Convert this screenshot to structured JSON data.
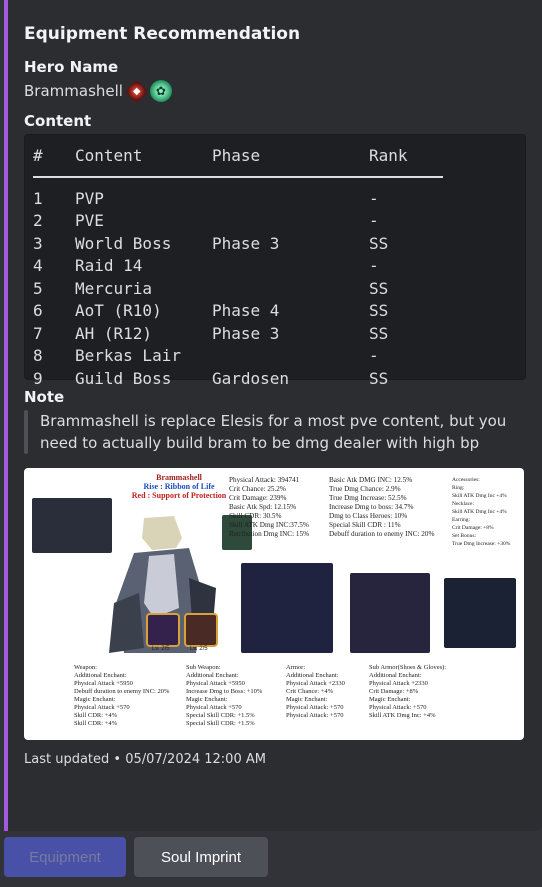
{
  "embed": {
    "title": "Equipment Recommendation",
    "hero_field": {
      "name": "Hero Name",
      "value": "Brammashell"
    },
    "content_field": {
      "name": "Content"
    },
    "table": {
      "headers": [
        "#",
        "Content",
        "Phase",
        "Rank"
      ],
      "rows": [
        [
          "1",
          "PVP",
          "",
          "-"
        ],
        [
          "2",
          "PVE",
          "",
          "-"
        ],
        [
          "3",
          "World Boss",
          "Phase 3",
          "SS"
        ],
        [
          "4",
          "Raid 14",
          "",
          "-"
        ],
        [
          "5",
          "Mercuria",
          "",
          "SS"
        ],
        [
          "6",
          "AoT (R10)",
          "Phase 4",
          "SS"
        ],
        [
          "7",
          "AH (R12)",
          "Phase 3",
          "SS"
        ],
        [
          "8",
          "Berkas Lair",
          "",
          "-"
        ],
        [
          "9",
          "Guild Boss",
          "Gardosen",
          "SS"
        ]
      ]
    },
    "note_field": {
      "name": "Note",
      "value": "Brammashell is replace Elesis for a most pve content, but you need to actually build bram to be dmg dealer with high bp"
    },
    "image": {
      "hero_title": "Brammashell",
      "hero_sub1": "Rise : Ribbon of Life",
      "hero_sub2": "Red : Support of Protection",
      "level_left": "Lv. 2/5",
      "level_right": "Lv. 2/5",
      "stats_col1": [
        "Physical Attack: 394741",
        "Crit Chance: 25.2%",
        "Crit Damage: 239%",
        "Basic Atk Spd: 12.15%",
        "Skill CDR: 30.5%",
        "Skill ATK Dmg INC:37.5%",
        "Retribution Dmg INC: 15%"
      ],
      "stats_col2": [
        "Basic Atk DMG INC: 12.5%",
        "True Dmg Chance: 2.9%",
        "True Dmg Increase: 52.5%",
        "Increase Dmg to boss: 34.7%",
        "Dmg to Class Heroes: 10%",
        "Special Skill CDR : 11%",
        "Debuff duration to enemy INC: 20%"
      ],
      "stats_col3": [
        "Accessories:",
        "Ring:",
        "Skill ATK Dmg Inc +4%",
        "Necklace:",
        "Skill ATK Dmg Inc +4%",
        "Earring:",
        "Crit Damage: +8%",
        "Set Bonus:",
        "True Dmg Increase: +30%"
      ],
      "bottom_weapon": [
        "Weapon:",
        "Additional Enchant:",
        "Physical Attack +5950",
        "Debuff duration to enemy INC: 20%",
        "Magic Enchant:",
        "Physical Attack +570",
        "Skill CDR: +4%",
        "Skill CDR: +4%"
      ],
      "bottom_subweapon": [
        "Sub Weapon:",
        "Additional Enchant:",
        "Physical Attack +5950",
        "Increase Dmg to Boss: +10%",
        "Magic Enchant:",
        "Physical Attack +570",
        "Special Skill CDR: +1.5%",
        "Special Skill CDR: +1.5%"
      ],
      "bottom_armor": [
        "Armor:",
        "Additional Enchant:",
        "Physical Attack +2330",
        "Crit Chance: +4%",
        "Magic Enchant:",
        "Physical Attack: +570",
        "Physical Attack: +570"
      ],
      "bottom_subarmor": [
        "Sub Armor(Shoes & Gloves):",
        "Additional Enchant:",
        "Physical Attack +2330",
        "Crit Damage: +8%",
        "Magic Enchant:",
        "Physical Attack: +570",
        "Skill ATK Dmg Inc: +4%"
      ]
    },
    "footer": "Last updated • 05/07/2024 12:00 AM"
  },
  "buttons": {
    "equipment": "Equipment",
    "soul_imprint": "Soul Imprint"
  },
  "colors": {
    "accent_bar": "#a25ae0",
    "embed_bg": "#2b2d31",
    "page_bg": "#313338",
    "primary_button": "#5865f2",
    "secondary_button": "#4e5058"
  },
  "icons": {
    "hero_emoji_1": "red-element-icon",
    "hero_emoji_2": "green-class-icon"
  }
}
